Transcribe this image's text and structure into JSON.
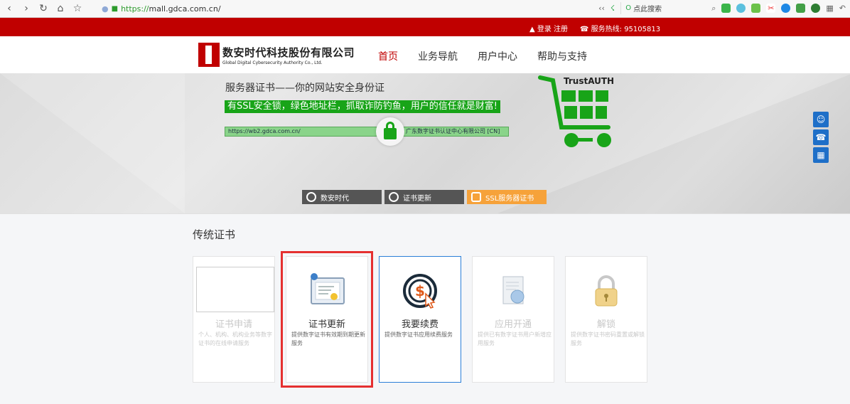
{
  "browser": {
    "url_scheme": "https://",
    "url_rest": "mall.gdca.com.cn/",
    "search_placeholder": "点此搜索"
  },
  "topbar": {
    "login": "登录 注册",
    "hotline": "服务热线: 95105813"
  },
  "logo": {
    "name_cn": "数安时代科技股份有限公司",
    "name_en": "Global Digital Cybersecurity Authority Co., Ltd."
  },
  "nav": {
    "items": [
      {
        "label": "首页",
        "active": true
      },
      {
        "label": "业务导航",
        "active": false
      },
      {
        "label": "用户中心",
        "active": false
      },
      {
        "label": "帮助与支持",
        "active": false
      }
    ]
  },
  "banner": {
    "title": "服务器证书——你的网站安全身份证",
    "slogan": "有SSL安全锁，绿色地址栏，抓取诈防钓鱼，用户的信任就是财富!",
    "ssl_url": "https://wb2.gdca.com.cn/",
    "ssl_org": "广东数字证书认证中心有限公司 [CN]",
    "trust_label": "TrustAUTH",
    "tabs": [
      {
        "label": "数安时代",
        "active": false
      },
      {
        "label": "证书更新",
        "active": false
      },
      {
        "label": "SSL服务器证书",
        "active": true
      }
    ]
  },
  "section": {
    "title": "传统证书"
  },
  "cards": [
    {
      "title": "证书申请",
      "desc": "个人、机构、机构业务等数字证书的在线申请服务",
      "icon": "broken-image-icon",
      "state": "dim"
    },
    {
      "title": "证书更新",
      "desc": "提供数字证书有效期到期更新服务",
      "icon": "certificate-icon",
      "state": "selected"
    },
    {
      "title": "我要续费",
      "desc": "提供数字证书应用续费服务",
      "icon": "dollar-icon",
      "state": "hover"
    },
    {
      "title": "应用开通",
      "desc": "提供已有数字证书用户新增应用服务",
      "icon": "document-globe-icon",
      "state": "dim"
    },
    {
      "title": "解锁",
      "desc": "提供数字证书密码重置或解锁服务",
      "icon": "padlock-icon",
      "state": "dim"
    }
  ],
  "colors": {
    "brand_red": "#c00000",
    "ssl_green": "#18a418",
    "tab_orange": "#f6a23a",
    "selection_red": "#e53030",
    "hover_blue": "#2b7fd8"
  }
}
